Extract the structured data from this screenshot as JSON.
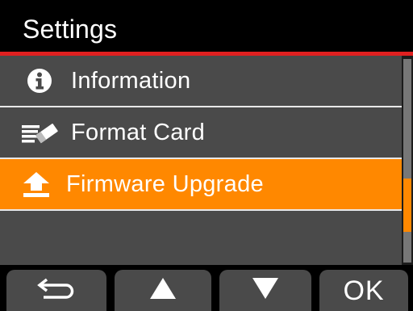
{
  "header": {
    "title": "Settings"
  },
  "menu": {
    "items": [
      {
        "label": "Information",
        "icon": "info-icon",
        "selected": false
      },
      {
        "label": "Format Card",
        "icon": "format-card-icon",
        "selected": false
      },
      {
        "label": "Firmware Upgrade",
        "icon": "upload-icon",
        "selected": true
      }
    ]
  },
  "softkeys": {
    "back_icon": "back-arrow-icon",
    "up_icon": "up-triangle-icon",
    "down_icon": "down-triangle-icon",
    "ok_label": "OK"
  },
  "scroll": {
    "position_fraction": 0.75
  },
  "colors": {
    "accent_red": "#e02020",
    "selected_orange": "#ff8800",
    "panel_gray": "#4a4a4a",
    "background": "#000000"
  }
}
